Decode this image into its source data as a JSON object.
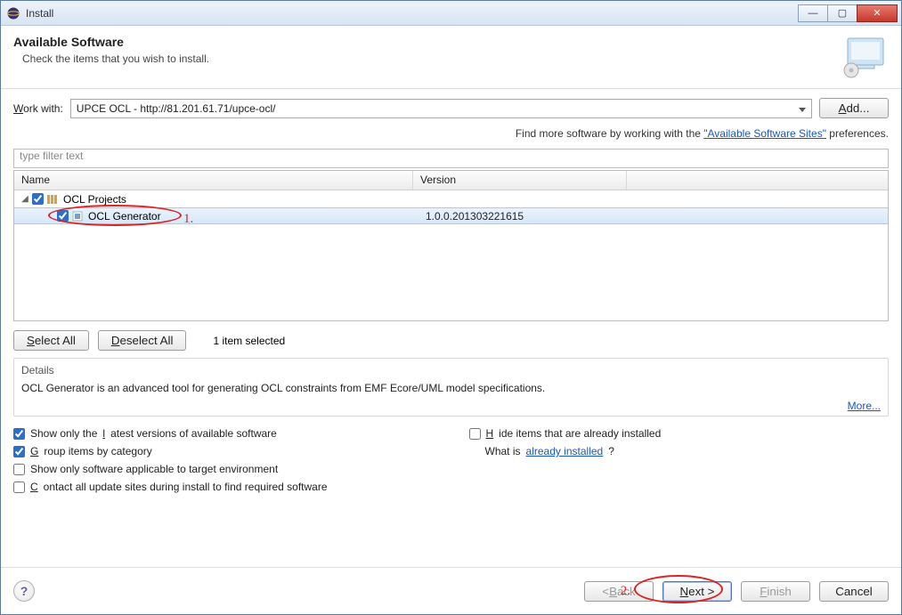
{
  "window": {
    "title": "Install"
  },
  "header": {
    "title": "Available Software",
    "subtitle": "Check the items that you wish to install."
  },
  "workwith": {
    "label_pre": "W",
    "label_rest": "ork with:",
    "value": "UPCE OCL - http://81.201.61.71/upce-ocl/",
    "add_label": "Add..."
  },
  "hint": {
    "prefix": "Find more software by working with the ",
    "link": "\"Available Software Sites\"",
    "suffix": " preferences."
  },
  "filter": {
    "placeholder": "type filter text"
  },
  "columns": {
    "name": "Name",
    "version": "Version"
  },
  "tree": {
    "category": {
      "label": "OCL Projects",
      "checked": true,
      "expanded": true
    },
    "item": {
      "label": "OCL Generator",
      "version": "1.0.0.201303221615",
      "checked": true,
      "selected": true
    }
  },
  "select_all": "Select All",
  "deselect_all": "Deselect All",
  "item_selected": "1 item selected",
  "details": {
    "header": "Details",
    "text": "OCL Generator is an advanced tool for generating OCL constraints from EMF Ecore/UML model specifications.",
    "more": "More..."
  },
  "options": {
    "show_latest": "Show only the latest versions of available software",
    "group_by_category": "Group items by category",
    "applicable_env": "Show only software applicable to target environment",
    "contact_sites": "Contact all update sites during install to find required software",
    "hide_installed": "Hide items that are already installed",
    "what_is_prefix": "What is ",
    "already_installed": "already installed",
    "what_is_suffix": "?"
  },
  "checks": {
    "show_latest": true,
    "group_by_category": true,
    "applicable_env": false,
    "contact_sites": false,
    "hide_installed": false
  },
  "buttons": {
    "back": "< Back",
    "next": "Next >",
    "finish": "Finish",
    "cancel": "Cancel"
  },
  "annotations": {
    "one": "1.",
    "two": "2."
  }
}
